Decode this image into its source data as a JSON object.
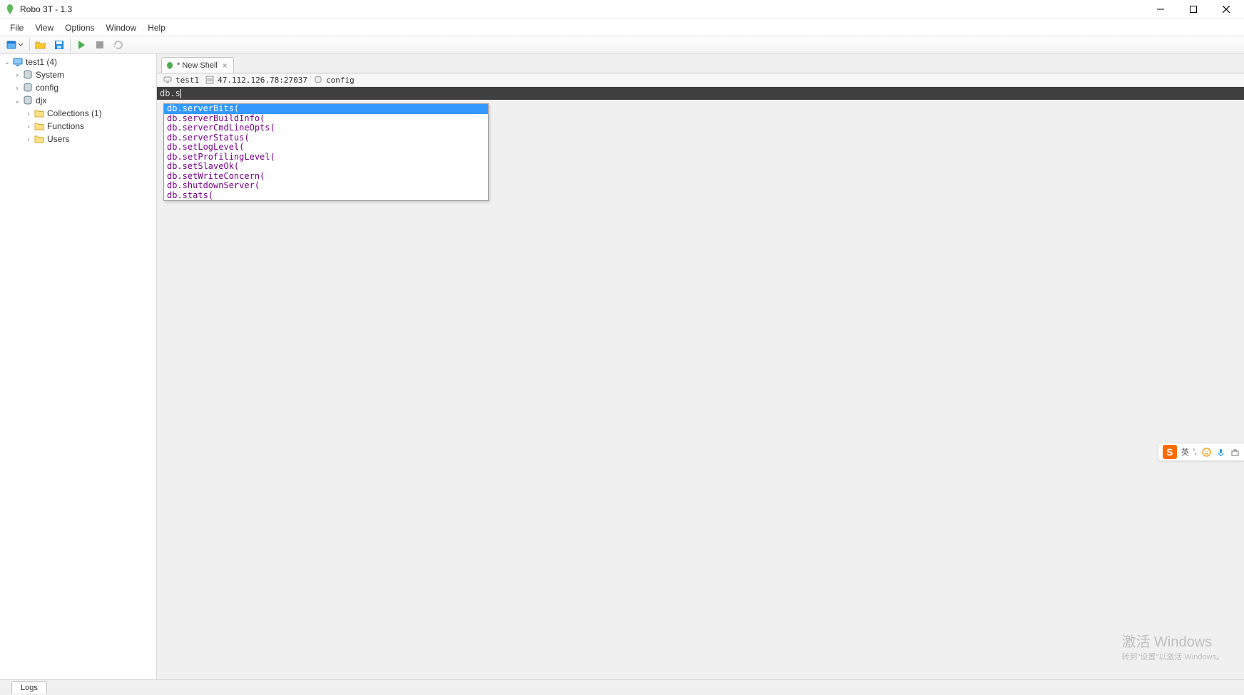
{
  "title": "Robo 3T - 1.3",
  "menu": [
    "File",
    "View",
    "Options",
    "Window",
    "Help"
  ],
  "tree": {
    "connection": "test1 (4)",
    "items": [
      "System",
      "config",
      "djx"
    ],
    "djx_children": [
      "Collections (1)",
      "Functions",
      "Users"
    ]
  },
  "tab": {
    "label": "* New Shell"
  },
  "context": {
    "conn": "test1",
    "host": "47.112.126.78:27037",
    "db": "config"
  },
  "editor_text": "db.s",
  "autocomplete": [
    "db.serverBits(",
    "db.serverBuildInfo(",
    "db.serverCmdLineOpts(",
    "db.serverStatus(",
    "db.setLogLevel(",
    "db.setProfilingLevel(",
    "db.setSlaveOk(",
    "db.setWriteConcern(",
    "db.shutdownServer(",
    "db.stats("
  ],
  "status": {
    "logs": "Logs"
  },
  "watermark": {
    "l1": "激活 Windows",
    "l2": "转到\"设置\"以激活 Windows。"
  },
  "ime": {
    "lang": "英",
    "punct": "',"
  }
}
